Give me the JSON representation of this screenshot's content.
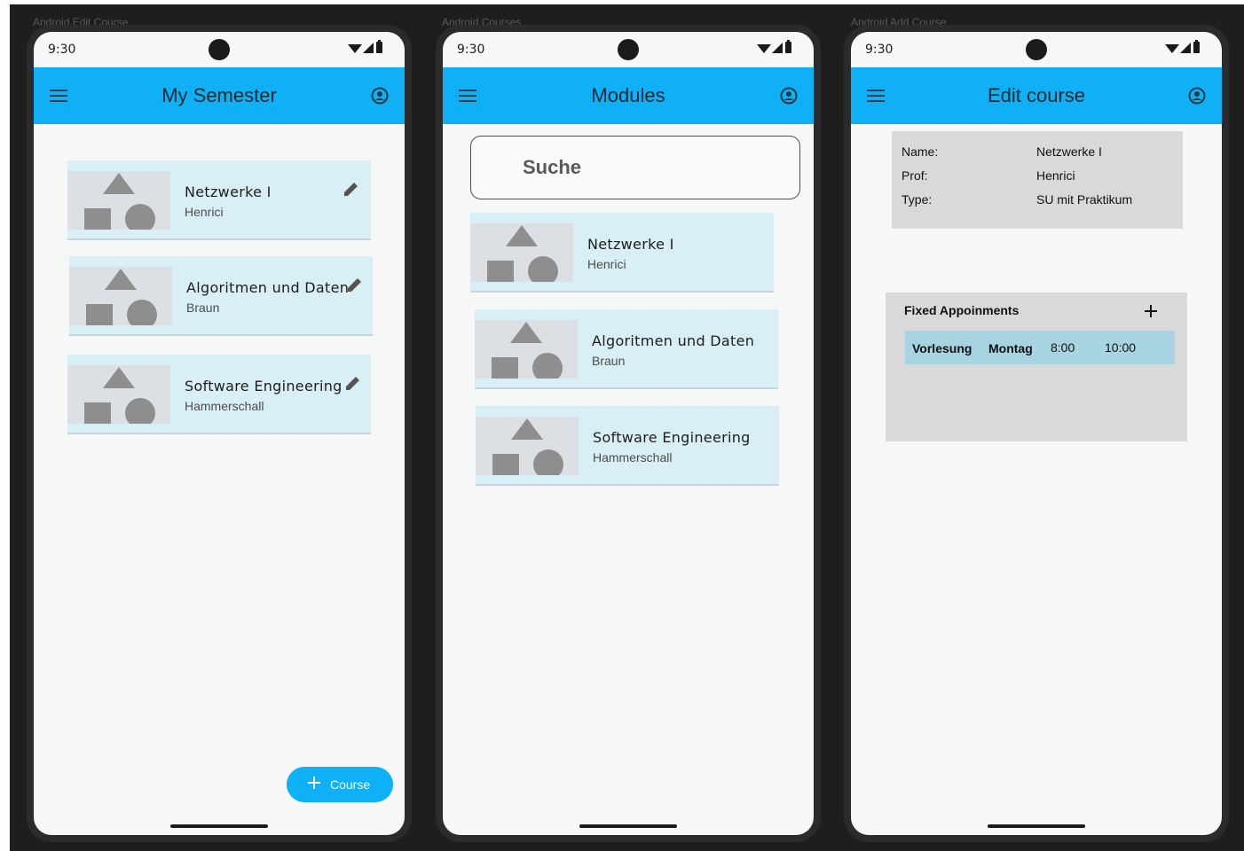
{
  "frames": [
    {
      "label": "Android Edit Course",
      "status": {
        "time": "9:30"
      },
      "appbar": {
        "title": "My Semester"
      },
      "cards": [
        {
          "title": "Netzwerke I",
          "subtitle": "Henrici"
        },
        {
          "title": "Algoritmen und Daten",
          "subtitle": "Braun"
        },
        {
          "title": "Software Engineering",
          "subtitle": "Hammerschall"
        }
      ],
      "fab": {
        "label": "Course",
        "icon": "plus-icon"
      }
    },
    {
      "label": "Android Courses",
      "status": {
        "time": "9:30"
      },
      "appbar": {
        "title": "Modules"
      },
      "search": {
        "placeholder": "Suche"
      },
      "cards": [
        {
          "title": "Netzwerke I",
          "subtitle": "Henrici"
        },
        {
          "title": "Algoritmen und Daten",
          "subtitle": "Braun"
        },
        {
          "title": "Software Engineering",
          "subtitle": "Hammerschall"
        }
      ]
    },
    {
      "label": "Android Add Course",
      "status": {
        "time": "9:30"
      },
      "appbar": {
        "title": "Edit course"
      },
      "info": {
        "name_label": "Name:",
        "name_value": "Netzwerke I",
        "prof_label": "Prof:",
        "prof_value": "Henrici",
        "type_label": "Type:",
        "type_value": "SU mit Praktikum"
      },
      "appointments": {
        "title": "Fixed Appoinments",
        "rows": [
          {
            "kind": "Vorlesung",
            "day": "Montag",
            "start": "8:00",
            "end": "10:00"
          }
        ]
      }
    }
  ],
  "colors": {
    "appbar": "#0fb0f5",
    "card": "#d9eff6",
    "appointment_row": "#a8d3e0",
    "panel": "#d9d9d9"
  }
}
